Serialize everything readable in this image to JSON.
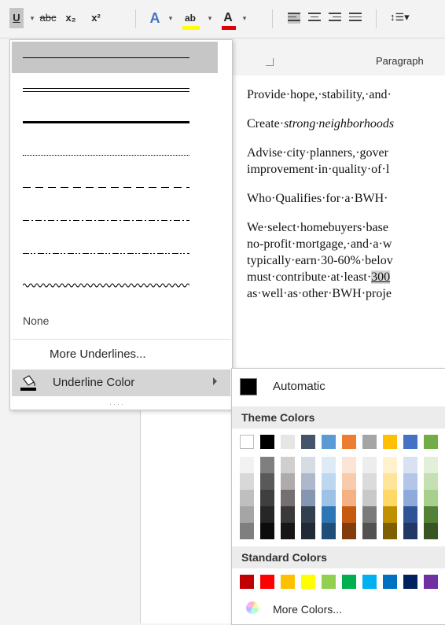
{
  "ribbon": {
    "underline_label": "U",
    "strikethrough_label": "abc",
    "subscript_label": "x₂",
    "superscript_label": "x²",
    "text_effects_label": "A",
    "highlight_label": "ab",
    "font_color_label": "A",
    "highlight_color": "#ffff00",
    "font_color_bar": "#e00000"
  },
  "group_label": {
    "paragraph": "Paragraph"
  },
  "document": {
    "lines": [
      "Provide·hope,·stability,·and·",
      "Create·strong·neighborhoods",
      "Advise·city·planners,·gover",
      "improvement·in·quality·of·l",
      "Who·Qualifies·for·a·BWH·",
      "We·select·homebuyers·base",
      "no-profit·mortgage,·and·a·w",
      "typically·earn·30-60%·belov",
      "must·contribute·at·least·",
      "300",
      "as·well·as·other·BWH·proje"
    ]
  },
  "underline_menu": {
    "none_label": "None",
    "more_underlines": "More Underlines...",
    "underline_color": "Underline Color"
  },
  "color_menu": {
    "automatic": "Automatic",
    "theme_colors_title": "Theme Colors",
    "standard_colors_title": "Standard Colors",
    "more_colors": "More Colors...",
    "theme_top": [
      "#ffffff",
      "#000000",
      "#e7e6e6",
      "#44546a",
      "#5b9bd5",
      "#ed7d31",
      "#a5a5a5",
      "#ffc000",
      "#4472c4",
      "#70ad47"
    ],
    "theme_shades": [
      [
        "#f2f2f2",
        "#7f7f7f",
        "#d0cece",
        "#d6dce4",
        "#deebf6",
        "#fbe5d5",
        "#ededed",
        "#fff2cc",
        "#d9e2f3",
        "#e2efd9"
      ],
      [
        "#d8d8d8",
        "#595959",
        "#aeabab",
        "#adb9ca",
        "#bdd7ee",
        "#f7cbac",
        "#dbdbdb",
        "#fee599",
        "#b4c6e7",
        "#c5e0b3"
      ],
      [
        "#bfbfbf",
        "#3f3f3f",
        "#757070",
        "#8496b0",
        "#9cc3e5",
        "#f4b183",
        "#c9c9c9",
        "#ffd965",
        "#8eaadb",
        "#a8d08d"
      ],
      [
        "#a5a5a5",
        "#262626",
        "#3a3838",
        "#323f4f",
        "#2e75b5",
        "#c55a11",
        "#7b7b7b",
        "#bf9000",
        "#2f5496",
        "#538135"
      ],
      [
        "#7f7f7f",
        "#0c0c0c",
        "#171616",
        "#222a35",
        "#1e4e79",
        "#833c0b",
        "#525252",
        "#7f6000",
        "#1f3864",
        "#375623"
      ]
    ],
    "standard": [
      "#c00000",
      "#ff0000",
      "#ffc000",
      "#ffff00",
      "#92d050",
      "#00b050",
      "#00b0f0",
      "#0070c0",
      "#002060",
      "#7030a0"
    ]
  }
}
